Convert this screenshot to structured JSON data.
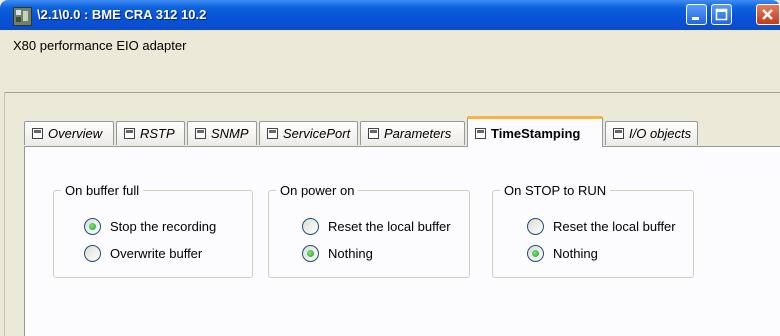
{
  "window": {
    "title": "\\2.1\\0.0 : BME CRA 312 10.2",
    "icon": "app-module-icon",
    "buttons": [
      "minimize",
      "maximize",
      "close"
    ]
  },
  "subtitle": "X80 performance EIO adapter",
  "tabs": [
    {
      "label": "Overview",
      "active": false
    },
    {
      "label": "RSTP",
      "active": false
    },
    {
      "label": "SNMP",
      "active": false
    },
    {
      "label": "ServicePort",
      "active": false
    },
    {
      "label": "Parameters",
      "active": false
    },
    {
      "label": "TimeStamping",
      "active": true
    },
    {
      "label": "I/O objects",
      "active": false
    }
  ],
  "groups": [
    {
      "title": "On buffer full",
      "options": [
        {
          "label": "Stop the recording",
          "selected": true
        },
        {
          "label": "Overwrite buffer",
          "selected": false
        }
      ]
    },
    {
      "title": "On power on",
      "options": [
        {
          "label": "Reset the local buffer",
          "selected": false
        },
        {
          "label": "Nothing",
          "selected": true
        }
      ]
    },
    {
      "title": "On STOP to RUN",
      "options": [
        {
          "label": "Reset the local buffer",
          "selected": false
        },
        {
          "label": "Nothing",
          "selected": true
        }
      ]
    }
  ],
  "colors": {
    "title_bar": "#0a5bd8",
    "active_tab_accent": "#f8b53a",
    "radio_selected": "#21a121"
  }
}
